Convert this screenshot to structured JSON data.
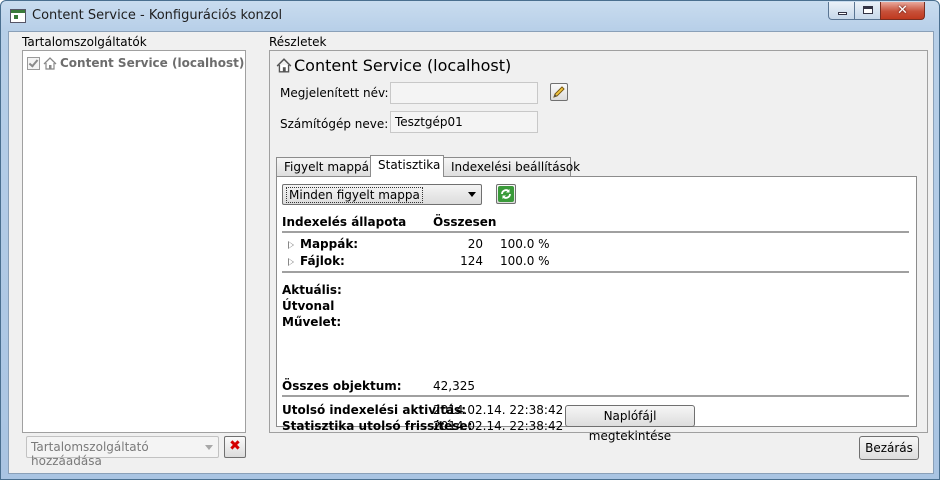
{
  "window": {
    "title": "Content Service - Konfigurációs konzol",
    "close_glyph": "✕"
  },
  "left": {
    "section_label": "Tartalomszolgáltatók",
    "tree": [
      {
        "label": "Content Service (localhost)",
        "checked": true
      }
    ],
    "add_provider_placeholder": "Tartalomszolgáltató hozzáadása",
    "delete_glyph": "✖"
  },
  "right": {
    "section_label": "Részletek",
    "header_title": "Content Service (localhost)",
    "display_name_label": "Megjelenített név:",
    "display_name_value": "",
    "computer_name_label": "Számítógép neve:",
    "computer_name_value": "Tesztgép01",
    "tabs": [
      {
        "label": "Figyelt mappák",
        "active": false
      },
      {
        "label": "Statisztika",
        "active": true
      },
      {
        "label": "Indexelési beállítások",
        "active": false
      }
    ],
    "stats": {
      "folder_filter": "Minden figyelt mappa",
      "col_status": "Indexelés állapota",
      "col_total": "Összesen",
      "rows": [
        {
          "label": "Mappák:",
          "count": "20",
          "percent": "100.0 %"
        },
        {
          "label": "Fájlok:",
          "count": "124",
          "percent": "100.0 %"
        }
      ],
      "current_label": "Aktuális:",
      "path_label": "Útvonal",
      "operation_label": "Művelet:",
      "total_objects_label": "Összes objektum:",
      "total_objects_value": "42,325",
      "last_activity_label": "Utolsó indexelési aktivitás:",
      "last_activity_value": "2014.02.14. 22:38:42",
      "last_refresh_label": "Statisztika utolsó frissítése:",
      "last_refresh_value": "2014.02.14. 22:38:42",
      "view_log_label": "Naplófájl megtekintése"
    }
  },
  "footer": {
    "close_label": "Bezárás"
  },
  "colors": {
    "accent": "#3a7a3a",
    "delete_red": "#d40000",
    "title_bar": "#b7cfe8"
  }
}
